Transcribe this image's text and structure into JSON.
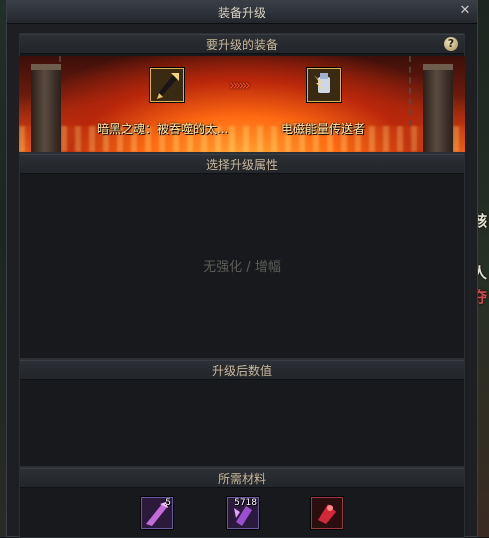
{
  "window": {
    "title": "装备升级",
    "close_icon": "close-icon"
  },
  "sections": {
    "equipment": {
      "title": "要升级的装备",
      "help_label": "?"
    },
    "attributes": {
      "title": "选择升级属性",
      "hint": "无强化 / 增幅"
    },
    "after_values": {
      "title": "升级后数值"
    },
    "materials": {
      "title": "所需材料"
    }
  },
  "upgrade": {
    "source_item": {
      "name": "暗黑之魂：被吞噬的太...",
      "icon": "dark-spear-item-icon"
    },
    "arrow": "»»»",
    "target_item": {
      "name": "电磁能量传送者",
      "icon": "electro-glove-item-icon"
    }
  },
  "materials": [
    {
      "icon": "purple-shard-material-icon",
      "count": "5"
    },
    {
      "icon": "purple-crystal-material-icon",
      "count": "5718"
    },
    {
      "icon": "red-essence-material-icon",
      "count": ""
    }
  ],
  "background_side_text": [
    "骸",
    "人",
    "夺"
  ],
  "colors": {
    "lava": "#ff6a12",
    "gold_border": "#d9b25a",
    "header_text": "#c8b89a",
    "item_name": "#ffe7a6"
  }
}
